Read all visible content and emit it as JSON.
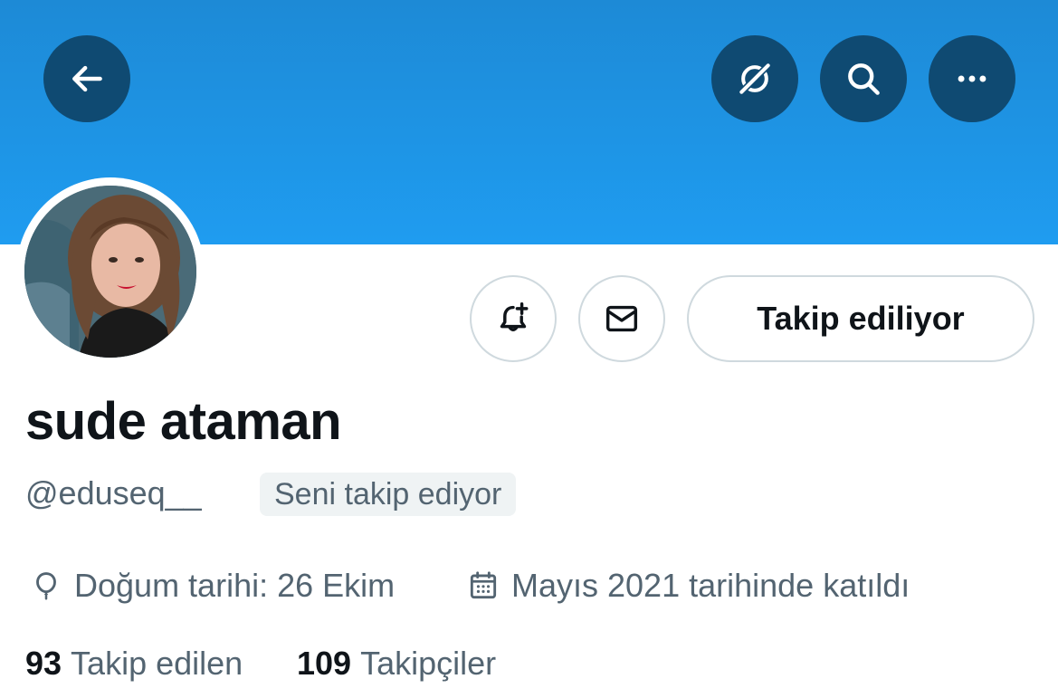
{
  "header": {
    "back_icon": "arrow-left-icon",
    "grok_icon": "grok-icon",
    "search_icon": "search-icon",
    "more_icon": "more-horizontal-icon",
    "banner_color": "#1d8ad6"
  },
  "actions": {
    "notify_icon": "bell-plus-icon",
    "dm_icon": "envelope-icon",
    "follow_label": "Takip ediliyor"
  },
  "profile": {
    "display_name": "sude ataman",
    "handle": "@eduseq__",
    "follows_you_badge": "Seni takip ediyor"
  },
  "meta": {
    "birthday": "Doğum tarihi: 26 Ekim",
    "joined": "Mayıs 2021 tarihinde katıldı"
  },
  "stats": {
    "following_count": "93",
    "following_label": "Takip edilen",
    "followers_count": "109",
    "followers_label": "Takipçiler"
  }
}
